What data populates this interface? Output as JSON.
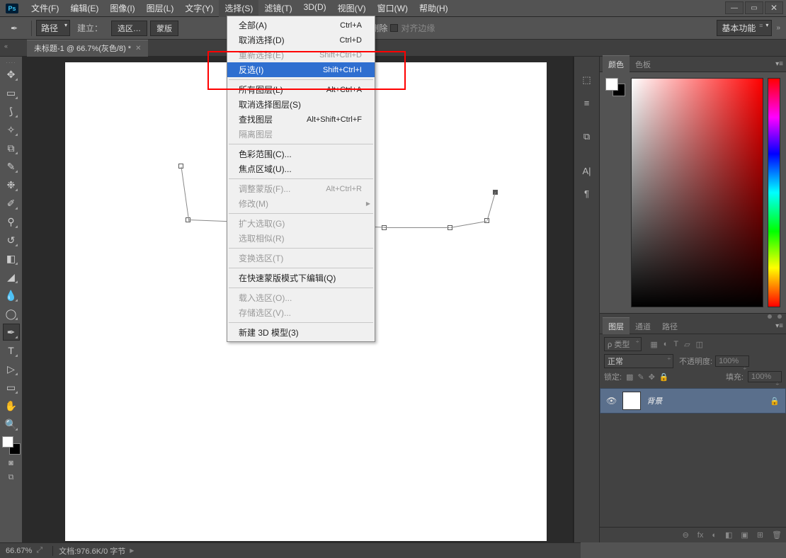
{
  "app": {
    "logo": "Ps"
  },
  "menubar": [
    {
      "label": "文件(F)"
    },
    {
      "label": "编辑(E)"
    },
    {
      "label": "图像(I)"
    },
    {
      "label": "图层(L)"
    },
    {
      "label": "文字(Y)"
    },
    {
      "label": "选择(S)",
      "active": true
    },
    {
      "label": "滤镜(T)"
    },
    {
      "label": "3D(D)"
    },
    {
      "label": "视图(V)"
    },
    {
      "label": "窗口(W)"
    },
    {
      "label": "帮助(H)"
    }
  ],
  "options": {
    "pathLabel": "路径",
    "makeLabel": "建立：",
    "btn1": "选区…",
    "btn2": "蒙版",
    "autoAddDelete": "动添加/删除",
    "alignEdges": "对齐边缘",
    "workspace": "基本功能"
  },
  "docTab": {
    "title": "未标题-1 @ 66.7%(灰色/8) *"
  },
  "status": {
    "zoom": "66.67%",
    "doc": "文档:976.6K/0 字节"
  },
  "dropdown": {
    "groups": [
      [
        {
          "label": "全部(A)",
          "shortcut": "Ctrl+A"
        },
        {
          "label": "取消选择(D)",
          "shortcut": "Ctrl+D"
        },
        {
          "label": "重新选择(E)",
          "shortcut": "Shift+Ctrl+D",
          "disabled": true
        },
        {
          "label": "反选(I)",
          "shortcut": "Shift+Ctrl+I",
          "highlight": true,
          "disabled": true
        }
      ],
      [
        {
          "label": "所有图层(L)",
          "shortcut": "Alt+Ctrl+A"
        },
        {
          "label": "取消选择图层(S)"
        },
        {
          "label": "查找图层",
          "shortcut": "Alt+Shift+Ctrl+F"
        },
        {
          "label": "隔离图层",
          "disabled": true
        }
      ],
      [
        {
          "label": "色彩范围(C)..."
        },
        {
          "label": "焦点区域(U)..."
        }
      ],
      [
        {
          "label": "调整蒙版(F)...",
          "shortcut": "Alt+Ctrl+R",
          "disabled": true
        },
        {
          "label": "修改(M)",
          "hassub": true,
          "disabled": true
        }
      ],
      [
        {
          "label": "扩大选取(G)",
          "disabled": true
        },
        {
          "label": "选取相似(R)",
          "disabled": true
        }
      ],
      [
        {
          "label": "变换选区(T)",
          "disabled": true
        }
      ],
      [
        {
          "label": "在快速蒙版模式下编辑(Q)"
        }
      ],
      [
        {
          "label": "载入选区(O)...",
          "disabled": true
        },
        {
          "label": "存储选区(V)...",
          "disabled": true
        }
      ],
      [
        {
          "label": "新建 3D 模型(3)"
        }
      ]
    ]
  },
  "colorPanel": {
    "tab1": "颜色",
    "tab2": "色板"
  },
  "layersPanel": {
    "tabs": [
      "图层",
      "通道",
      "路径"
    ],
    "kind": "ρ 类型",
    "blend": "正常",
    "opacityLabel": "不透明度:",
    "opacity": "100%",
    "lockLabel": "锁定:",
    "fillLabel": "填充:",
    "fill": "100%",
    "bgName": "背景"
  },
  "dockIcons": [
    "⬚",
    "≡",
    "⧉",
    "A|",
    "¶"
  ],
  "layerFooterIcons": [
    "⊖",
    "fx",
    "◐",
    "◧",
    "▣",
    "⊞",
    "🗑"
  ]
}
